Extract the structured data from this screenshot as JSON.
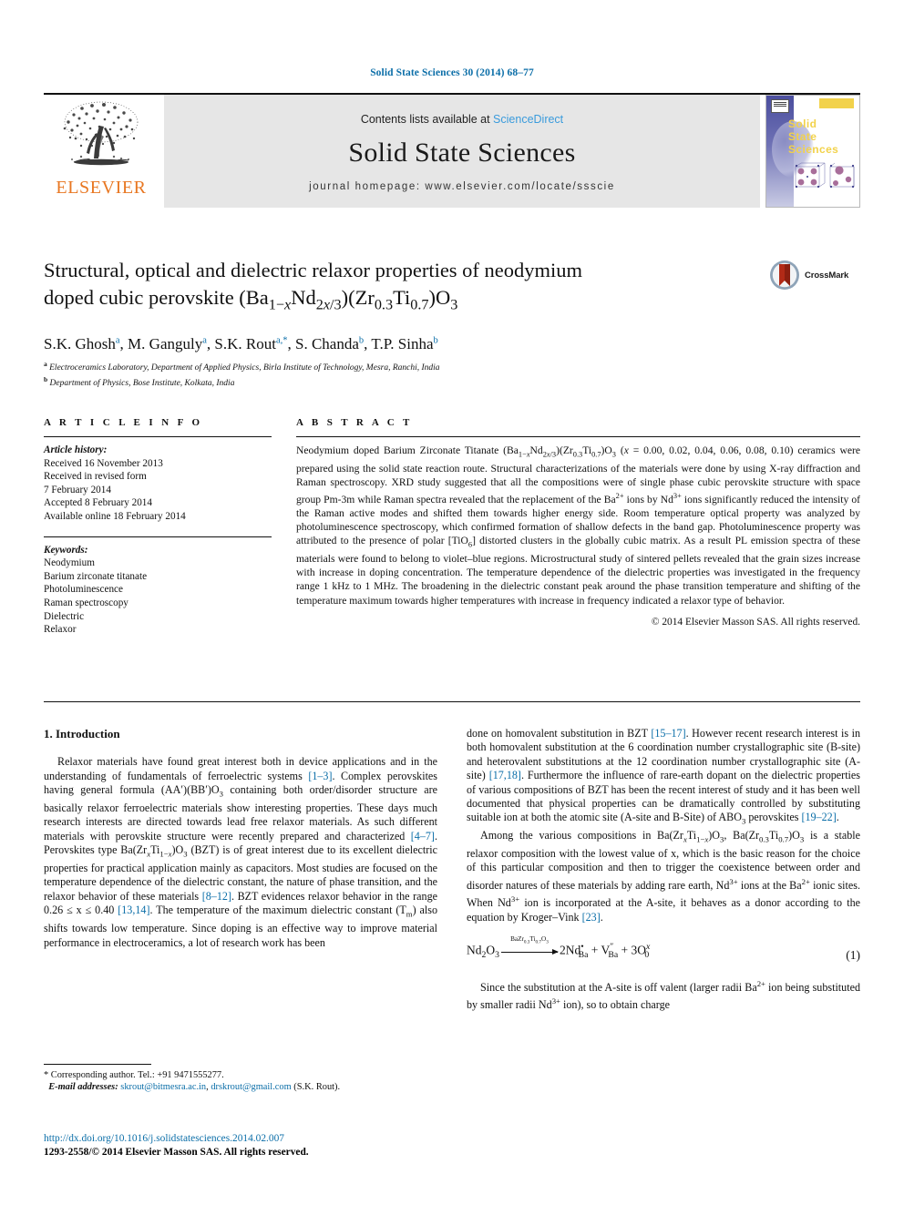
{
  "running_head": "Solid State Sciences 30 (2014) 68–77",
  "masthead": {
    "publisher": "ELSEVIER",
    "contents_prefix": "Contents lists available at ",
    "contents_link": "ScienceDirect",
    "journal_title": "Solid State Sciences",
    "homepage": "journal homepage: www.elsevier.com/locate/ssscie",
    "cover_title_line1": "Solid",
    "cover_title_line2": "State",
    "cover_title_line3": "Sciences"
  },
  "article": {
    "title_line1": "Structural, optical and dielectric relaxor properties of neodymium",
    "title_line2_pre": "doped cubic perovskite (Ba",
    "crossmark_label": "CrossMark",
    "authors": "S.K. Ghosh, M. Ganguly, S.K. Rout, S. Chanda, T.P. Sinha",
    "affiliation_a": "Electroceramics Laboratory, Department of Applied Physics, Birla Institute of Technology, Mesra, Ranchi, India",
    "affiliation_b": "Department of Physics, Bose Institute, Kolkata, India"
  },
  "article_info": {
    "heading": "A R T I C L E    I N F O",
    "history_label": "Article history:",
    "history": [
      "Received 16 November 2013",
      "Received in revised form",
      "7 February 2014",
      "Accepted 8 February 2014",
      "Available online 18 February 2014"
    ],
    "keywords_label": "Keywords:",
    "keywords": [
      "Neodymium",
      "Barium zirconate titanate",
      "Photoluminescence",
      "Raman spectroscopy",
      "Dielectric",
      "Relaxor"
    ]
  },
  "abstract": {
    "heading": "A B S T R A C T",
    "text_part1": "Neodymium doped Barium Zirconate Titanate (Ba",
    "text_rest": "ceramics were prepared using the solid state reaction route. Structural characterizations of the materials were done by using X-ray diffraction and Raman spectroscopy. XRD study suggested that all the compositions were of single phase cubic perovskite structure with space group Pm-3m while Raman spectra revealed that the replacement of the Ba",
    "text_rest2": "ions by Nd",
    "text_rest3": "ions significantly reduced the intensity of the Raman active modes and shifted them towards higher energy side. Room temperature optical property was analyzed by photoluminescence spectroscopy, which confirmed formation of shallow defects in the band gap. Photoluminescence property was attributed to the presence of polar [TiO",
    "text_rest4": "] distorted clusters in the globally cubic matrix. As a result PL emission spectra of these materials were found to belong to violet–blue regions. Microstructural study of sintered pellets revealed that the grain sizes increase with increase in doping concentration. The temperature dependence of the dielectric properties was investigated in the frequency range 1 kHz to 1 MHz. The broadening in the dielectric constant peak around the phase transition temperature and shifting of the temperature maximum towards higher temperatures with increase in frequency indicated a relaxor type of behavior.",
    "copyright": "© 2014 Elsevier Masson SAS. All rights reserved."
  },
  "body": {
    "section_heading": "1. Introduction",
    "left_p1_a": "Relaxor materials have found great interest both in device applications and in the understanding of fundamentals of ferroelectric systems ",
    "left_ref_1_3": "[1–3]",
    "left_p1_b": ". Complex perovskites having general formula (AA′)(BB′)O",
    "left_p1_c": " containing both order/disorder structure are basically relaxor ferroelectric materials show interesting properties. These days much research interests are directed towards lead free relaxor materials. As such different materials with perovskite structure were recently prepared and characterized ",
    "left_ref_4_7": "[4–7]",
    "left_p1_d": ". Perovskites type Ba(Zr",
    "left_p1_e": " (BZT) is of great interest due to its excellent dielectric properties for practical application mainly as capacitors. Most studies are focused on the temperature dependence of the dielectric constant, the nature of phase transition, and the relaxor behavior of these materials ",
    "left_ref_8_12": "[8–12]",
    "left_p1_f": ". BZT evidences relaxor behavior in the range 0.26 ≤ x ≤ 0.40 ",
    "left_ref_13_14": "[13,14]",
    "left_p1_g": ". The temperature of the maximum dielectric constant (T",
    "left_p1_h": ") also shifts towards low temperature. Since doping is an effective way to improve material performance in electroceramics, a lot of research work has been",
    "right_p1_a": "done on homovalent substitution in BZT ",
    "right_ref_15_17": "[15–17]",
    "right_p1_b": ". However recent research interest is in both homovalent substitution at the 6 coordination number crystallographic site (B-site) and heterovalent substitutions at the 12 coordination number crystallographic site (A-site) ",
    "right_ref_17_18": "[17,18]",
    "right_p1_c": ". Furthermore the influence of rare-earth dopant on the dielectric properties of various compositions of BZT has been the recent interest of study and it has been well documented that physical properties can be dramatically controlled by substituting suitable ion at both the atomic site (A-site and B-Site) of ABO",
    "right_p1_d": " perovskites ",
    "right_ref_19_22": "[19–22]",
    "right_p1_e": ".",
    "right_p2_a": "Among the various compositions in Ba(Zr",
    "right_p2_b": " is a stable relaxor composition with the lowest value of x, which is the basic reason for the choice of this particular composition and then to trigger the coexistence between order and disorder natures of these materials by adding rare earth, Nd",
    "right_p2_c": " ions at the Ba",
    "right_p2_d": " ionic sites. When Nd",
    "right_p2_e": " ion is incorporated at the A-site, it behaves as a donor according to the equation by Kroger–Vink ",
    "right_ref_23": "[23]",
    "right_p2_f": ".",
    "equation_number": "(1)",
    "equation_arrow_label": "BaZr0.3Ti0.7O3",
    "right_p3_a": "Since the substitution at the A-site is off valent (larger radii Ba",
    "right_p3_b": " ion being substituted by smaller radii Nd",
    "right_p3_c": " ion), so to obtain charge"
  },
  "footer": {
    "corresponding": "* Corresponding author. Tel.: +91 9471555277.",
    "email_label": "E-mail addresses:",
    "email1": "skrout@bitmesra.ac.in",
    "email2": "drskrout@gmail.com",
    "email_attrib": "(S.K. Rout).",
    "doi": "http://dx.doi.org/10.1016/j.solidstatesciences.2014.02.007",
    "issn_line": "1293-2558/© 2014 Elsevier Masson SAS. All rights reserved."
  },
  "colors": {
    "link_blue": "#0b6ea8",
    "sciencedirect_blue": "#3a9bdc",
    "elsevier_orange": "#E87722",
    "band_gray": "#e6e6e6",
    "cover_yellow": "#f2d24b",
    "cover_purple": "#4b4e9e",
    "crossmark_red": "#b22a17"
  }
}
